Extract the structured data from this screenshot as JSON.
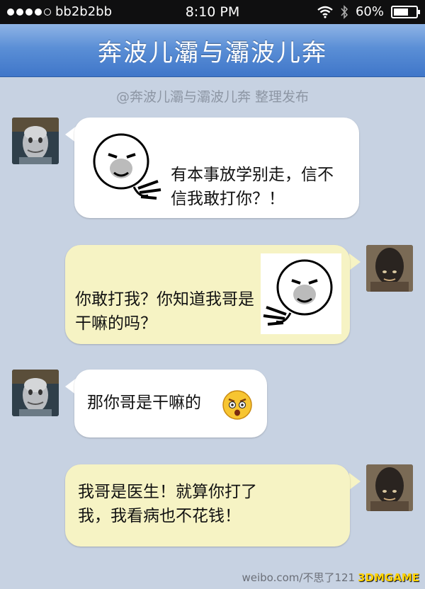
{
  "status_bar": {
    "carrier": "bb2b2bb",
    "time": "8:10 PM",
    "battery": "60%"
  },
  "header": {
    "title": "奔波儿灞与灞波儿奔"
  },
  "byline": "@奔波儿灞与灞波儿奔 整理发布",
  "messages": [
    {
      "side": "left",
      "text": "有本事放学别走，信不信我敢打你？！",
      "sticker": "meme-face-pointing"
    },
    {
      "side": "right",
      "text": "你敢打我？你知道我哥是干嘛的吗？",
      "sticker": "meme-face-pointing"
    },
    {
      "side": "left",
      "text": "那你哥是干嘛的",
      "emoji": "shocked-face"
    },
    {
      "side": "right",
      "text": "我哥是医生！就算你打了我，我看病也不花钱！"
    }
  ],
  "watermark": {
    "text": "weibo.com/不思了121",
    "brand": "3DMGAME"
  },
  "colors": {
    "background": "#c7d2e2",
    "titlebar": "#4f86d2",
    "left_bubble": "#ffffff",
    "right_bubble": "#f6f3c4"
  }
}
